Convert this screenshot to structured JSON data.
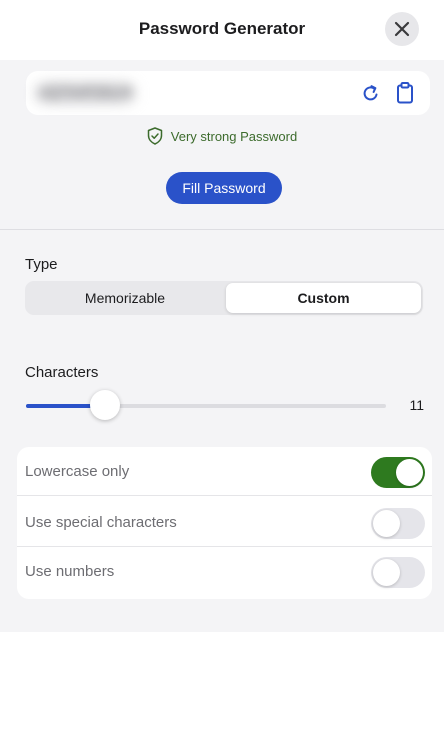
{
  "header": {
    "title": "Password Generator",
    "close_icon": "close-icon"
  },
  "password": {
    "value": "xQ7!mP2kLr9",
    "regenerate_icon": "refresh-icon",
    "copy_icon": "clipboard-icon",
    "strength_icon": "shield-check-icon",
    "strength_text": "Very strong Password",
    "fill_button": "Fill Password"
  },
  "type": {
    "label": "Type",
    "options": [
      "Memorizable",
      "Custom"
    ],
    "selected": "Custom"
  },
  "characters": {
    "label": "Characters",
    "value": "11",
    "slider_fraction": 0.22
  },
  "options": [
    {
      "label": "Lowercase only",
      "enabled": true
    },
    {
      "label": "Use special characters",
      "enabled": false
    },
    {
      "label": "Use numbers",
      "enabled": false
    }
  ],
  "colors": {
    "accent": "#2a52c9",
    "toggle_on": "#2e7a1f",
    "strength": "#3c6b2c"
  }
}
